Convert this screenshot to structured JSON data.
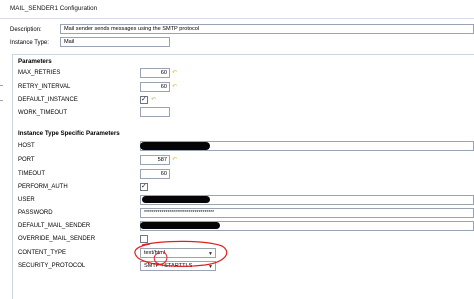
{
  "window_title": "MAIL_SENDER1 Configuration",
  "description": {
    "label": "Description:",
    "value": "Mail sender sends messages using the SMTP protocol"
  },
  "instance_type": {
    "label": "Instance Type:",
    "value": "Mail"
  },
  "parameters": {
    "heading": "Parameters",
    "max_retries": {
      "label": "MAX_RETRIES",
      "value": "60"
    },
    "retry_interval": {
      "label": "RETRY_INTERVAL",
      "value": "60"
    },
    "default_instance": {
      "label": "DEFAULT_INSTANCE",
      "checked": true
    },
    "work_timeout": {
      "label": "WORK_TIMEOUT",
      "value": ""
    }
  },
  "instance_params": {
    "heading": "Instance Type Specific Parameters",
    "host": {
      "label": "HOST"
    },
    "port": {
      "label": "PORT",
      "value": "587"
    },
    "timeout": {
      "label": "TIMEOUT",
      "value": "60"
    },
    "perform_auth": {
      "label": "PERFORM_AUTH",
      "checked": true
    },
    "user": {
      "label": "USER"
    },
    "password": {
      "label": "PASSWORD",
      "value": "************************************"
    },
    "default_mail_sender": {
      "label": "DEFAULT_MAIL_SENDER"
    },
    "override_mail_sender": {
      "label": "OVERRIDE_MAIL_SENDER",
      "checked": false
    },
    "content_type": {
      "label": "CONTENT_TYPE",
      "value": "text/html"
    },
    "security_protocol": {
      "label": "SECURITY_PROTOCOL",
      "value": "SMTP +STARTTLS"
    }
  },
  "colors": {
    "annotation_red": "#e02020",
    "redaction": "#050505",
    "reset_icon": "#d8b84a"
  }
}
